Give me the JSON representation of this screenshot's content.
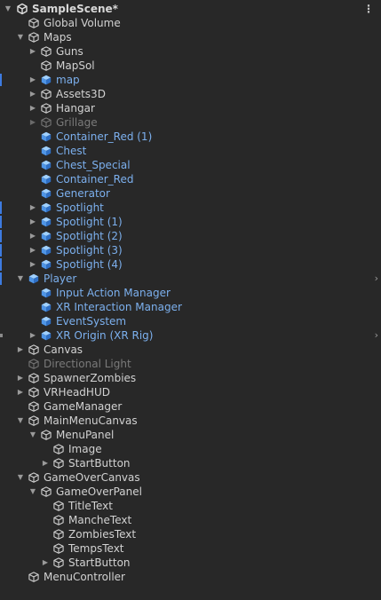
{
  "scene": {
    "title": "SampleScene*"
  },
  "colors": {
    "background": "#282828",
    "text": "#d2d2d2",
    "prefab": "#7cb0ee",
    "inactive": "#7a7a7a",
    "marker": "#3d7be0"
  },
  "icons": {
    "gameobject": "cube-icon",
    "prefab": "prefab-cube-icon",
    "scene": "unity-scene-icon",
    "menu": "vertical-dots-icon"
  },
  "rows": [
    {
      "label": "Global Volume",
      "depth": 1,
      "arrow": "none",
      "kind": "normal"
    },
    {
      "label": "Maps",
      "depth": 1,
      "arrow": "expanded",
      "kind": "normal"
    },
    {
      "label": "Guns",
      "depth": 2,
      "arrow": "collapsed",
      "kind": "normal"
    },
    {
      "label": "MapSol",
      "depth": 2,
      "arrow": "none",
      "kind": "normal"
    },
    {
      "label": "map",
      "depth": 2,
      "arrow": "collapsed",
      "kind": "prefab",
      "marked": true
    },
    {
      "label": "Assets3D",
      "depth": 2,
      "arrow": "collapsed",
      "kind": "normal"
    },
    {
      "label": "Hangar",
      "depth": 2,
      "arrow": "collapsed",
      "kind": "normal"
    },
    {
      "label": "Grillage",
      "depth": 2,
      "arrow": "collapsed",
      "kind": "inactive"
    },
    {
      "label": "Container_Red (1)",
      "depth": 2,
      "arrow": "none",
      "kind": "prefab"
    },
    {
      "label": "Chest",
      "depth": 2,
      "arrow": "none",
      "kind": "prefab"
    },
    {
      "label": "Chest_Special",
      "depth": 2,
      "arrow": "none",
      "kind": "prefab"
    },
    {
      "label": "Container_Red",
      "depth": 2,
      "arrow": "none",
      "kind": "prefab"
    },
    {
      "label": "Generator",
      "depth": 2,
      "arrow": "none",
      "kind": "prefab"
    },
    {
      "label": "Spotlight",
      "depth": 2,
      "arrow": "collapsed",
      "kind": "prefab",
      "marked": true
    },
    {
      "label": "Spotlight (1)",
      "depth": 2,
      "arrow": "collapsed",
      "kind": "prefab",
      "marked": true
    },
    {
      "label": "Spotlight (2)",
      "depth": 2,
      "arrow": "collapsed",
      "kind": "prefab",
      "marked": true
    },
    {
      "label": "Spotlight (3)",
      "depth": 2,
      "arrow": "collapsed",
      "kind": "prefab",
      "marked": true
    },
    {
      "label": "Spotlight (4)",
      "depth": 2,
      "arrow": "collapsed",
      "kind": "prefab",
      "marked": true
    },
    {
      "label": "Player",
      "depth": 1,
      "arrow": "expanded",
      "kind": "prefab",
      "marked": true,
      "chevron": true
    },
    {
      "label": "Input Action Manager",
      "depth": 2,
      "arrow": "none",
      "kind": "prefab"
    },
    {
      "label": "XR Interaction Manager",
      "depth": 2,
      "arrow": "none",
      "kind": "prefab"
    },
    {
      "label": "EventSystem",
      "depth": 2,
      "arrow": "none",
      "kind": "prefab"
    },
    {
      "label": "XR Origin (XR Rig)",
      "depth": 2,
      "arrow": "collapsed",
      "kind": "prefab",
      "chevron": true,
      "nub": true
    },
    {
      "label": "Canvas",
      "depth": 1,
      "arrow": "collapsed",
      "kind": "normal"
    },
    {
      "label": "Directional Light",
      "depth": 1,
      "arrow": "none",
      "kind": "inactive"
    },
    {
      "label": "SpawnerZombies",
      "depth": 1,
      "arrow": "collapsed",
      "kind": "normal"
    },
    {
      "label": "VRHeadHUD",
      "depth": 1,
      "arrow": "collapsed",
      "kind": "normal"
    },
    {
      "label": "GameManager",
      "depth": 1,
      "arrow": "none",
      "kind": "normal"
    },
    {
      "label": "MainMenuCanvas",
      "depth": 1,
      "arrow": "expanded",
      "kind": "normal"
    },
    {
      "label": "MenuPanel",
      "depth": 2,
      "arrow": "expanded",
      "kind": "normal"
    },
    {
      "label": "Image",
      "depth": 3,
      "arrow": "none",
      "kind": "normal"
    },
    {
      "label": "StartButton",
      "depth": 3,
      "arrow": "collapsed",
      "kind": "normal"
    },
    {
      "label": "GameOverCanvas",
      "depth": 1,
      "arrow": "expanded",
      "kind": "normal"
    },
    {
      "label": "GameOverPanel",
      "depth": 2,
      "arrow": "expanded",
      "kind": "normal"
    },
    {
      "label": "TitleText",
      "depth": 3,
      "arrow": "none",
      "kind": "normal"
    },
    {
      "label": "MancheText",
      "depth": 3,
      "arrow": "none",
      "kind": "normal"
    },
    {
      "label": "ZombiesText",
      "depth": 3,
      "arrow": "none",
      "kind": "normal"
    },
    {
      "label": "TempsText",
      "depth": 3,
      "arrow": "none",
      "kind": "normal"
    },
    {
      "label": "StartButton",
      "depth": 3,
      "arrow": "collapsed",
      "kind": "normal"
    },
    {
      "label": "MenuController",
      "depth": 1,
      "arrow": "none",
      "kind": "normal"
    }
  ]
}
